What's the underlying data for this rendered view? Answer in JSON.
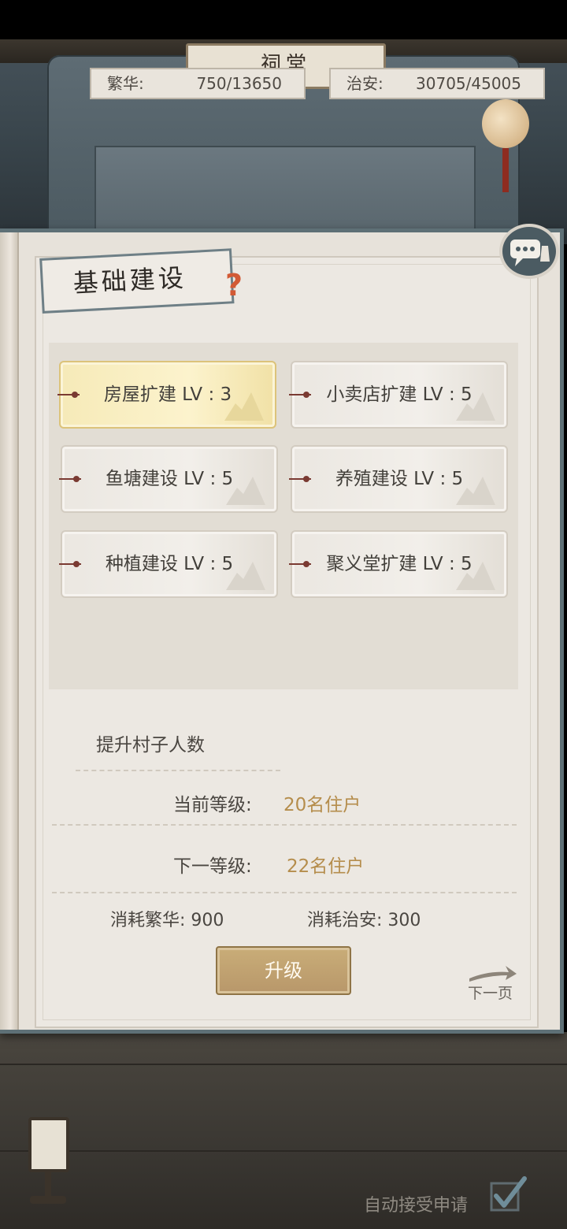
{
  "top_bar": {
    "plaque_title": "祠堂",
    "prosperity": {
      "label": "繁华:",
      "value": "750/13650"
    },
    "security": {
      "label": "治安:",
      "value": "30705/45005"
    }
  },
  "panel": {
    "section_title": "基础建设",
    "help_icon": "?",
    "buildings": [
      {
        "label": "房屋扩建 LV : 3",
        "selected": true
      },
      {
        "label": "小卖店扩建 LV : 5",
        "selected": false
      },
      {
        "label": "鱼塘建设 LV : 5",
        "selected": false
      },
      {
        "label": "养殖建设 LV : 5",
        "selected": false
      },
      {
        "label": "种植建设 LV : 5",
        "selected": false
      },
      {
        "label": "聚义堂扩建 LV : 5",
        "selected": false
      }
    ],
    "detail": {
      "description": "提升村子人数",
      "current_level_label": "当前等级:",
      "current_level_value": "20名住户",
      "next_level_label": "下一等级:",
      "next_level_value": "22名住户",
      "cost_prosperity_label": "消耗繁华:",
      "cost_prosperity_value": "900",
      "cost_security_label": "消耗治安:",
      "cost_security_value": "300"
    },
    "upgrade_button": "升级",
    "next_page_label": "下一页"
  },
  "footer": {
    "auto_accept_label": "自动接受申请",
    "auto_accept_checked": true
  },
  "colors": {
    "value_gold": "#b58d4c",
    "selected_card": "#fcf3cd",
    "button_gold": "#c9ad78",
    "frame_teal": "#5e7076"
  }
}
